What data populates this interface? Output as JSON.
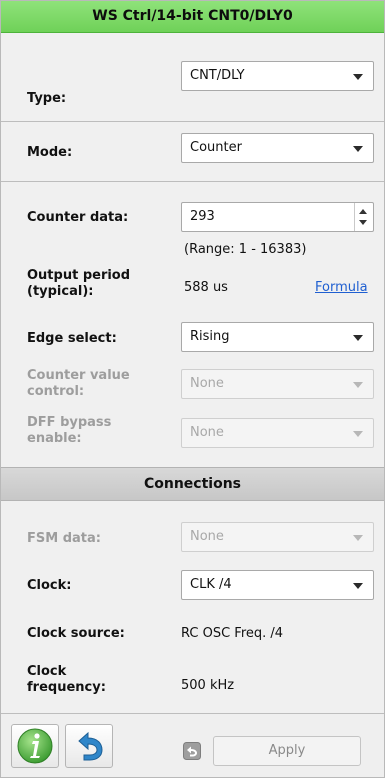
{
  "title": "WS Ctrl/14-bit CNT0/DLY0",
  "type": {
    "label": "Type:",
    "value": "CNT/DLY"
  },
  "mode": {
    "label": "Mode:",
    "value": "Counter"
  },
  "counter_data": {
    "label": "Counter data:",
    "value": "293",
    "range": "(Range:  1 - 16383)"
  },
  "output_period": {
    "label_line1": "Output period",
    "label_line2": "(typical):",
    "value": "588 us",
    "link": "Formula"
  },
  "edge_select": {
    "label": "Edge select:",
    "value": "Rising"
  },
  "counter_value_control": {
    "label_line1": "Counter value",
    "label_line2": "control:",
    "value": "None"
  },
  "dff_bypass": {
    "label_line1": "DFF bypass",
    "label_line2": "enable:",
    "value": "None"
  },
  "connections": {
    "header": "Connections",
    "fsm_data": {
      "label": "FSM data:",
      "value": "None"
    },
    "clock": {
      "label": "Clock:",
      "value": "CLK /4"
    },
    "clock_source": {
      "label": "Clock source:",
      "value": "RC OSC Freq. /4"
    },
    "clock_frequency": {
      "label_line1": "Clock",
      "label_line2": "frequency:",
      "value": "500 kHz"
    }
  },
  "footer": {
    "apply_label": "Apply"
  },
  "colors": {
    "title_bg": "#7bd865",
    "link": "#1f5fd1",
    "info_icon": "#57b94a",
    "undo_icon": "#2f86c9"
  },
  "icons": [
    "info-icon",
    "undo-icon",
    "undo-small-icon"
  ]
}
